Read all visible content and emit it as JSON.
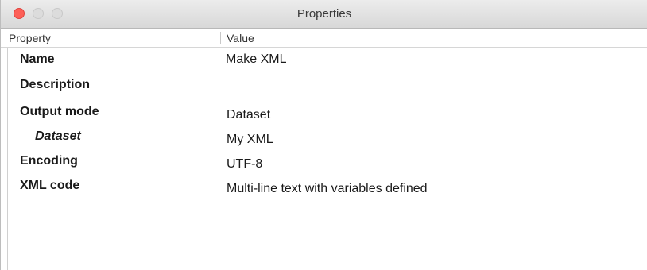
{
  "window": {
    "title": "Properties"
  },
  "table": {
    "columns": {
      "property": "Property",
      "value": "Value"
    },
    "rows": [
      {
        "name": "Name",
        "value": "Make XML"
      },
      {
        "name": "Description",
        "value": ""
      },
      {
        "name": "Output mode",
        "value": "Dataset"
      },
      {
        "name": "Dataset",
        "value": "My XML",
        "indented": true
      },
      {
        "name": "Encoding",
        "value": "UTF-8"
      },
      {
        "name": "XML code",
        "value": "Multi-line text with variables defined"
      }
    ]
  },
  "colors": {
    "close_button": "#fd5f57",
    "inactive_button": "#dcdcdc"
  }
}
